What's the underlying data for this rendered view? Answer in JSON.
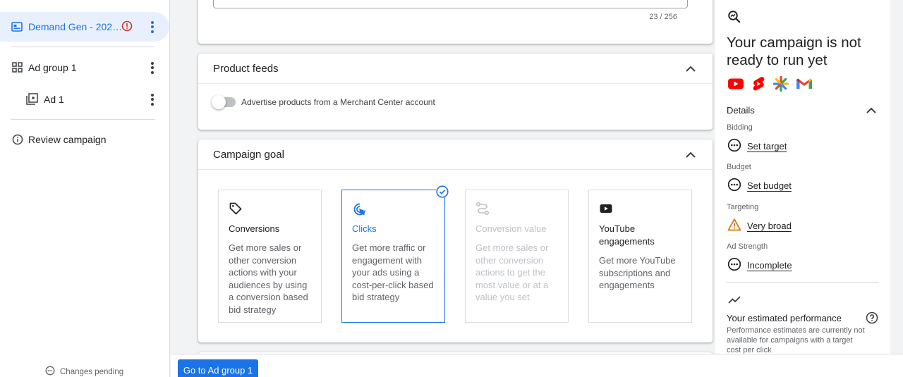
{
  "sidebar": {
    "campaign_label": "Demand Gen - 202…",
    "ad_group_label": "Ad group 1",
    "ad_label": "Ad 1",
    "review_label": "Review campaign",
    "pending_label": "Changes pending"
  },
  "main": {
    "char_counter": "23 / 256",
    "product_feeds": {
      "title": "Product feeds",
      "toggle_label": "Advertise products from a Merchant Center account"
    },
    "campaign_goal": {
      "title": "Campaign goal",
      "options": [
        {
          "title": "Conversions",
          "desc": "Get more sales or other conversion actions with your audiences by using a conversion based bid strategy",
          "icon": "tag-icon"
        },
        {
          "title": "Clicks",
          "desc": "Get more traffic or engagement with your ads using a cost-per-click based bid strategy",
          "icon": "cursor-click-icon",
          "selected": true
        },
        {
          "title": "Conversion value",
          "desc": "Get more sales or other conversion actions to get the most value or at a value you set",
          "icon": "route-icon",
          "disabled": true
        },
        {
          "title": "YouTube engagements",
          "desc": "Get more YouTube subscriptions and engagements",
          "icon": "youtube-icon"
        }
      ]
    },
    "go_button": "Go to Ad group 1"
  },
  "right_panel": {
    "title": "Your campaign is not ready to run yet",
    "details_label": "Details",
    "sections": [
      {
        "label": "Bidding",
        "value": "Set target",
        "status": "pending"
      },
      {
        "label": "Budget",
        "value": "Set budget",
        "status": "pending"
      },
      {
        "label": "Targeting",
        "value": "Very broad",
        "status": "warning"
      },
      {
        "label": "Ad Strength",
        "value": "Incomplete",
        "status": "pending"
      }
    ],
    "perf_title": "Your estimated performance",
    "perf_text": "Performance estimates are currently not available for campaigns with a target cost per click"
  },
  "colors": {
    "accent": "#1a73e8",
    "error": "#d93025",
    "warning": "#e37400"
  }
}
